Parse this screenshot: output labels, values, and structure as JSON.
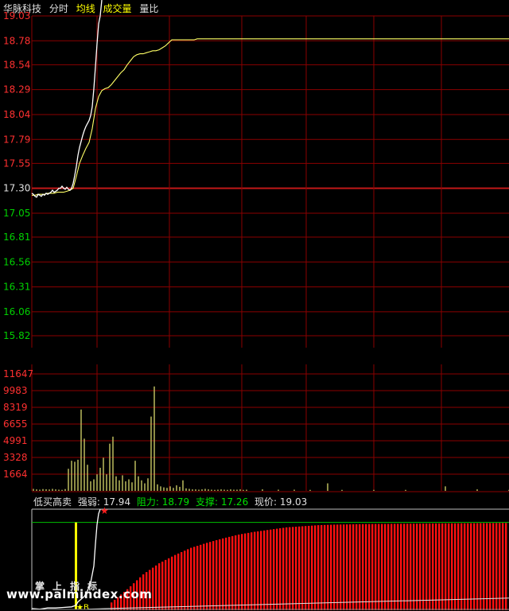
{
  "header": {
    "stock_name": "华脉科技",
    "tab_fenshi": "分时",
    "tab_junxian": "均线",
    "tab_volume": "成交量",
    "tab_liangbi": "量比"
  },
  "colors": {
    "background": "#000000",
    "grid": "#8b0000",
    "price_up": "#ff3030",
    "price_down": "#00d000",
    "price_line": "#ffffff",
    "avg_line": "#ffff66",
    "volume_bar": "#c8c864"
  },
  "indicator_panel": {
    "name": "低买高卖",
    "strength_label": "强弱:",
    "strength_value": "17.94",
    "resistance_label": "阻力:",
    "resistance_value": "18.79",
    "support_label": "支撑:",
    "support_value": "17.26",
    "price_label": "现价:",
    "price_value": "19.03",
    "palm_indicator_label": "掌上指标",
    "buy_marker": "★B"
  },
  "watermark": "www.palmindex.com",
  "chart_data": [
    {
      "type": "line",
      "panel": "price",
      "y_ticks": [
        "19.03",
        "18.78",
        "18.54",
        "18.29",
        "18.04",
        "17.79",
        "17.55",
        "17.30",
        "17.05",
        "16.81",
        "16.56",
        "16.31",
        "16.06",
        "15.82"
      ],
      "reference_price": 17.3,
      "ylim": [
        15.7,
        19.03
      ],
      "series": [
        {
          "role": "price",
          "x": [
            0,
            2,
            4,
            6,
            8,
            10,
            12,
            14,
            16,
            18,
            20,
            22,
            24,
            26,
            28,
            30,
            32,
            34,
            36,
            38,
            40,
            42,
            44,
            46,
            48,
            50,
            52,
            54,
            56,
            58,
            60,
            62,
            64,
            66,
            68,
            70,
            72,
            74,
            76,
            78,
            80,
            82,
            84,
            86
          ],
          "values": [
            17.25,
            17.24,
            17.22,
            17.21,
            17.24,
            17.23,
            17.22,
            17.24,
            17.23,
            17.25,
            17.24,
            17.25,
            17.26,
            17.28,
            17.26,
            17.27,
            17.28,
            17.3,
            17.3,
            17.32,
            17.3,
            17.29,
            17.31,
            17.29,
            17.28,
            17.3,
            17.35,
            17.43,
            17.52,
            17.63,
            17.71,
            17.77,
            17.83,
            17.88,
            17.92,
            17.95,
            17.98,
            18.03,
            18.12,
            18.3,
            18.52,
            18.75,
            18.95,
            19.03
          ]
        },
        {
          "role": "average",
          "x": [
            0,
            4,
            8,
            12,
            16,
            20,
            24,
            28,
            32,
            36,
            40,
            44,
            48,
            52,
            56,
            60,
            64,
            68,
            72,
            76,
            80,
            84,
            88,
            92,
            96,
            100,
            104,
            108,
            112,
            116,
            120,
            124,
            128,
            132,
            136,
            140,
            144,
            148,
            152,
            156,
            160,
            164,
            168,
            172,
            176,
            180,
            184,
            188,
            192,
            196,
            200,
            204,
            208,
            212,
            240,
            270,
            300,
            360,
            420,
            480,
            540,
            600
          ],
          "values": [
            17.23,
            17.23,
            17.24,
            17.24,
            17.24,
            17.25,
            17.25,
            17.25,
            17.26,
            17.26,
            17.26,
            17.27,
            17.28,
            17.3,
            17.42,
            17.55,
            17.63,
            17.7,
            17.76,
            17.9,
            18.1,
            18.22,
            18.28,
            18.3,
            18.31,
            18.34,
            18.38,
            18.42,
            18.46,
            18.49,
            18.54,
            18.58,
            18.62,
            18.64,
            18.65,
            18.65,
            18.66,
            18.67,
            18.68,
            18.68,
            18.69,
            18.71,
            18.73,
            18.76,
            18.79,
            18.79,
            18.79,
            18.79,
            18.79,
            18.79,
            18.79,
            18.79,
            18.8,
            18.8,
            18.8,
            18.8,
            18.8,
            18.8,
            18.8,
            18.8,
            18.8,
            18.8
          ]
        }
      ]
    },
    {
      "type": "bar",
      "panel": "volume",
      "y_ticks": [
        "11647",
        "9983",
        "8319",
        "6655",
        "4991",
        "3328",
        "1664"
      ],
      "ylim": [
        0,
        11647
      ],
      "x": [
        2,
        6,
        10,
        14,
        18,
        22,
        26,
        30,
        34,
        38,
        42,
        46,
        50,
        54,
        58,
        62,
        66,
        70,
        74,
        78,
        82,
        86,
        90,
        94,
        98,
        102,
        106,
        110,
        114,
        118,
        122,
        126,
        130,
        134,
        138,
        142,
        146,
        150,
        154,
        158,
        162,
        166,
        170,
        174,
        178,
        182,
        186,
        190,
        194,
        198,
        202,
        206,
        210,
        214,
        218,
        222,
        226,
        230,
        234,
        238,
        242,
        246,
        250,
        254,
        258,
        262,
        266,
        270,
        290,
        310,
        330,
        350,
        372,
        390,
        430,
        470,
        520,
        560,
        600
      ],
      "values": [
        200,
        150,
        120,
        180,
        160,
        140,
        200,
        150,
        120,
        100,
        180,
        2200,
        3000,
        2900,
        3100,
        8100,
        5200,
        2600,
        950,
        1150,
        1650,
        2300,
        3300,
        1650,
        4700,
        5400,
        1450,
        1050,
        1550,
        950,
        1150,
        850,
        3000,
        1450,
        1050,
        750,
        1250,
        7400,
        10400,
        650,
        450,
        350,
        300,
        450,
        300,
        550,
        400,
        1050,
        250,
        200,
        150,
        150,
        120,
        150,
        200,
        150,
        120,
        100,
        120,
        150,
        120,
        100,
        150,
        120,
        120,
        150,
        100,
        120,
        150,
        120,
        120,
        100,
        750,
        100,
        100,
        100,
        450,
        150,
        100
      ]
    },
    {
      "type": "bar",
      "panel": "indicator",
      "name": "低买高卖",
      "strength": 17.94,
      "resistance": 18.79,
      "support": 17.26,
      "current_price": 19.03,
      "ylim": [
        17.2,
        19.03
      ],
      "red_bars": {
        "x_start": 100,
        "x_end": 598,
        "step": 4,
        "values_at_x": [
          [
            100,
            17.34
          ],
          [
            120,
            17.58
          ],
          [
            140,
            17.85
          ],
          [
            160,
            18.05
          ],
          [
            180,
            18.2
          ],
          [
            200,
            18.33
          ],
          [
            220,
            18.42
          ],
          [
            240,
            18.5
          ],
          [
            260,
            18.57
          ],
          [
            280,
            18.62
          ],
          [
            300,
            18.66
          ],
          [
            320,
            18.7
          ],
          [
            340,
            18.72
          ],
          [
            360,
            18.74
          ],
          [
            380,
            18.75
          ],
          [
            420,
            18.76
          ],
          [
            598,
            18.78
          ]
        ]
      },
      "price_line": {
        "x": [
          0,
          10,
          20,
          30,
          40,
          50,
          54,
          56,
          58,
          62,
          66,
          70,
          74,
          78,
          80,
          82,
          84,
          86
        ],
        "values": [
          17.23,
          17.22,
          17.24,
          17.24,
          17.25,
          17.26,
          17.28,
          17.3,
          17.35,
          17.4,
          17.45,
          17.55,
          17.7,
          18.0,
          18.4,
          18.75,
          18.95,
          19.03
        ]
      }
    }
  ]
}
